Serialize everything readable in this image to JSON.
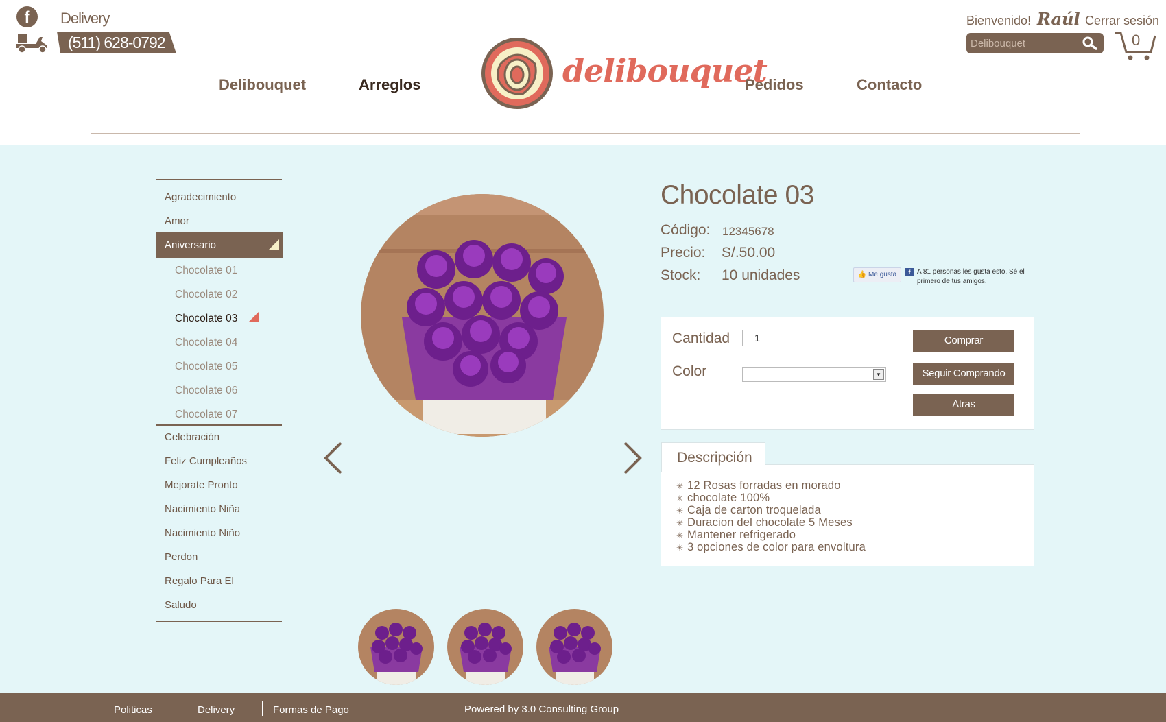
{
  "header": {
    "delivery_label": "Delivery",
    "phone": "(511) 628-0792",
    "nav": [
      {
        "label": "Delibouquet",
        "active": false
      },
      {
        "label": "Arreglos",
        "active": true
      },
      {
        "label": "Pedidos",
        "active": false
      },
      {
        "label": "Contacto",
        "active": false
      }
    ],
    "logo_text": "delibouquet",
    "welcome": "Bienvenido!",
    "user_name": "Raúl",
    "logout": "Cerrar sesión",
    "search_placeholder": "Delibouquet",
    "cart_count": "0"
  },
  "sidebar": {
    "categories_top": [
      "Agradecimiento",
      "Amor"
    ],
    "active_category": "Aniversario",
    "subitems": [
      "Chocolate 01",
      "Chocolate 02",
      "Chocolate 03",
      "Chocolate 04",
      "Chocolate 05",
      "Chocolate 06",
      "Chocolate 07"
    ],
    "current_subitem": "Chocolate 03",
    "categories_bottom": [
      "Celebración",
      "Feliz Cumpleaños",
      "Mejorate Pronto",
      "Nacimiento Niña",
      "Nacimiento Niño",
      "Perdon",
      "Regalo Para El",
      "Saludo"
    ]
  },
  "product": {
    "title": "Chocolate 03",
    "code_label": "Código:",
    "code": "12345678",
    "price_label": "Precio:",
    "price": "S/.50.00",
    "stock_label": "Stock:",
    "stock": "10 unidades",
    "like_button": "Me gusta",
    "like_text": "A 81 personas les gusta esto. Sé el primero de tus amigos."
  },
  "buy": {
    "qty_label": "Cantidad",
    "qty_value": "1",
    "color_label": "Color",
    "color_value": "",
    "buy_button": "Comprar",
    "continue_button": "Seguir Comprando",
    "back_button": "Atras"
  },
  "description": {
    "tab_label": "Descripción",
    "items": [
      "12 Rosas forradas en morado",
      "chocolate 100%",
      "Caja de carton troquelada",
      "Duracion del chocolate 5 Meses",
      "Mantener refrigerado",
      "3 opciones de color para envoltura"
    ]
  },
  "footer": {
    "links": [
      "Politicas",
      "Delivery",
      "Formas de Pago"
    ],
    "powered": "Powered by 3.0 Consulting Group"
  },
  "colors": {
    "brand_brown": "#7a6352",
    "accent_coral": "#e06a5c",
    "background": "#e4f6f8"
  },
  "icons": [
    "facebook-icon",
    "delivery-scooter-icon",
    "search-icon",
    "cart-icon",
    "chevron-left-icon",
    "chevron-right-icon",
    "thumbs-up-icon",
    "bullet-star-icon"
  ]
}
